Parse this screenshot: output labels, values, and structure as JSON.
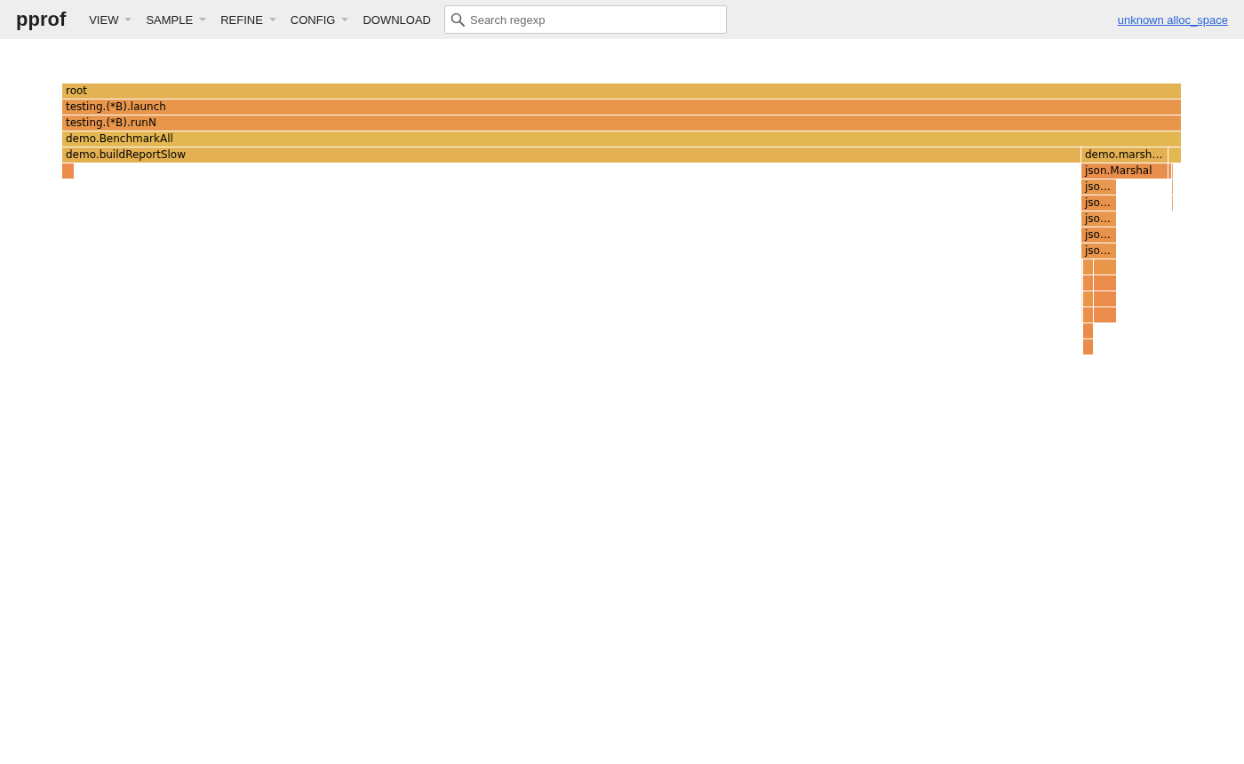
{
  "header": {
    "logo": "pprof",
    "menu": [
      {
        "label": "VIEW",
        "dropdown": true
      },
      {
        "label": "SAMPLE",
        "dropdown": true
      },
      {
        "label": "REFINE",
        "dropdown": true
      },
      {
        "label": "CONFIG",
        "dropdown": true
      },
      {
        "label": "DOWNLOAD",
        "dropdown": false
      }
    ],
    "search": {
      "placeholder": "Search regexp"
    },
    "profile_link": "unknown alloc_space"
  },
  "flame_graph": {
    "frames": [
      {
        "label": "root",
        "color": "#e3b252",
        "children": [
          {
            "label": "testing.(*B).launch",
            "color": "#e8964c",
            "children": [
              {
                "label": "testing.(*B).runN",
                "color": "#e8964c",
                "children": [
                  {
                    "label": "demo.BenchmarkAll",
                    "color": "#e3b751",
                    "children": [
                      {
                        "label": "demo.buildReportSlow",
                        "color": "#e3b052",
                        "children": [
                          {
                            "color": "#ec8c4c"
                          }
                        ]
                      },
                      {
                        "label": "demo.marsh…",
                        "color": "#e3b052",
                        "children": [
                          {
                            "label": "json.Marshal",
                            "color": "#e98f4d",
                            "children": [
                              {
                                "label": "jso…",
                                "color": "#e9984f",
                                "children": [
                                  {
                                    "label": "jso…",
                                    "color": "#e8924c",
                                    "children": [
                                      {
                                        "label": "jso…",
                                        "color": "#e9984e",
                                        "children": [
                                          {
                                            "label": "jso…",
                                            "color": "#e8924c",
                                            "children": [
                                              {
                                                "label": "jso…",
                                                "color": "#e9964d",
                                                "children": [
                                                  {
                                                    "color": "#f0d2b8",
                                                    "children": [
                                                      {
                                                        "color": "#f0d2b8",
                                                        "children": [
                                                          {
                                                            "color": "#f0d2b8",
                                                            "children": [
                                                              {
                                                                "color": "#f0d2b8"
                                                              }
                                                            ]
                                                          }
                                                        ]
                                                      }
                                                    ]
                                                  },
                                                  {
                                                    "color": "#e9964a",
                                                    "children": [
                                                      {
                                                        "color": "#ea904a",
                                                        "children": [
                                                          {
                                                            "color": "#e9964a",
                                                            "children": [
                                                              {
                                                                "color": "#ea904a",
                                                                "children": [
                                                                  {
                                                                    "color": "#eb8c4b",
                                                                    "children": [
                                                                      {
                                                                        "color": "#eb8c4b"
                                                                      }
                                                                    ]
                                                                  }
                                                                ]
                                                              }
                                                            ]
                                                          }
                                                        ]
                                                      }
                                                    ]
                                                  },
                                                  {
                                                    "color": "#e9964a",
                                                    "children": [
                                                      {
                                                        "color": "#eb8c4b",
                                                        "children": [
                                                          {
                                                            "color": "#eb8c4b",
                                                            "children": [
                                                              {
                                                                "color": "#eb8c4b"
                                                              }
                                                            ]
                                                          }
                                                        ]
                                                      }
                                                    ]
                                                  }
                                                ]
                                              }
                                            ]
                                          }
                                        ]
                                      }
                                    ]
                                  }
                                ]
                              }
                            ]
                          }
                        ]
                      },
                      {
                        "color": "#e3b852",
                        "children": [
                          {
                            "color": "#ec8f50"
                          },
                          {
                            "color": "#f0a870",
                            "children": [
                              {
                                "color": "#f0a870",
                                "children": [
                                  {
                                    "color": "#f0a870"
                                  }
                                ]
                              }
                            ]
                          }
                        ]
                      }
                    ]
                  }
                ]
              }
            ]
          }
        ]
      }
    ]
  }
}
